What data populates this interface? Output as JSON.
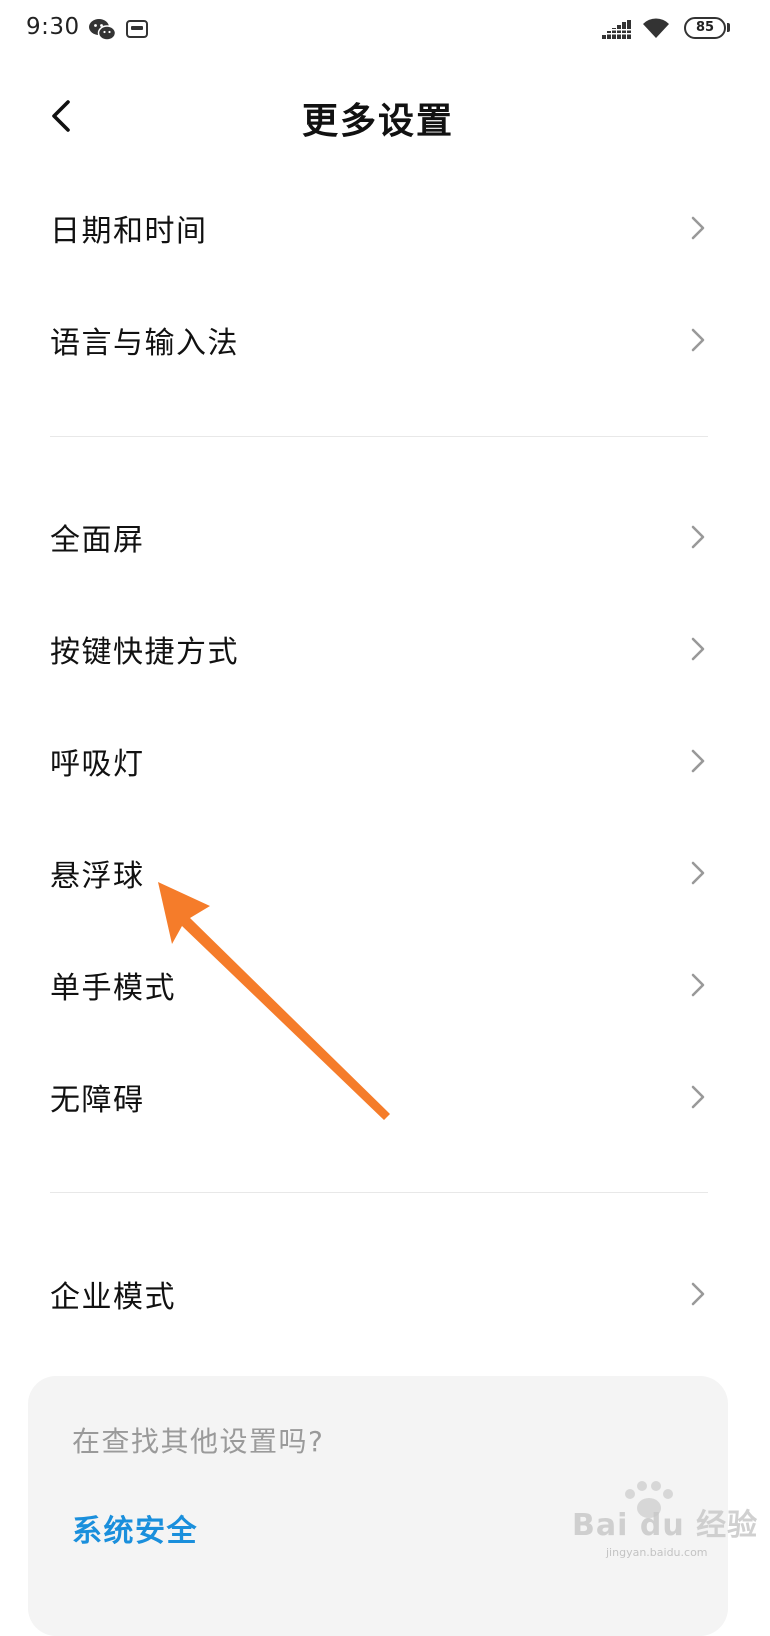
{
  "status_bar": {
    "time": "9:30",
    "battery_level": "85",
    "icons": [
      "wechat-icon",
      "voicemail-icon",
      "signal-icon",
      "wifi-icon",
      "battery-icon"
    ]
  },
  "header": {
    "title": "更多设置",
    "back_icon": "chevron-left-icon"
  },
  "sections": [
    {
      "items": [
        {
          "label": "日期和时间"
        },
        {
          "label": "语言与输入法"
        }
      ]
    },
    {
      "items": [
        {
          "label": "全面屏"
        },
        {
          "label": "按键快捷方式"
        },
        {
          "label": "呼吸灯"
        },
        {
          "label": "悬浮球"
        },
        {
          "label": "单手模式"
        },
        {
          "label": "无障碍"
        }
      ]
    },
    {
      "items": [
        {
          "label": "企业模式"
        }
      ]
    }
  ],
  "suggestion": {
    "prompt": "在查找其他设置吗?",
    "link": "系统安全"
  },
  "annotation": {
    "arrow_color": "#f57c2a",
    "points_to": "悬浮球"
  },
  "watermark": {
    "brand": "Bai du 经验",
    "url": "jingyan.baidu.com"
  },
  "colors": {
    "accent_link": "#1a8fdc",
    "divider": "#e8e8e8",
    "card_bg": "#f4f4f4",
    "muted_text": "#9a9a9a"
  }
}
